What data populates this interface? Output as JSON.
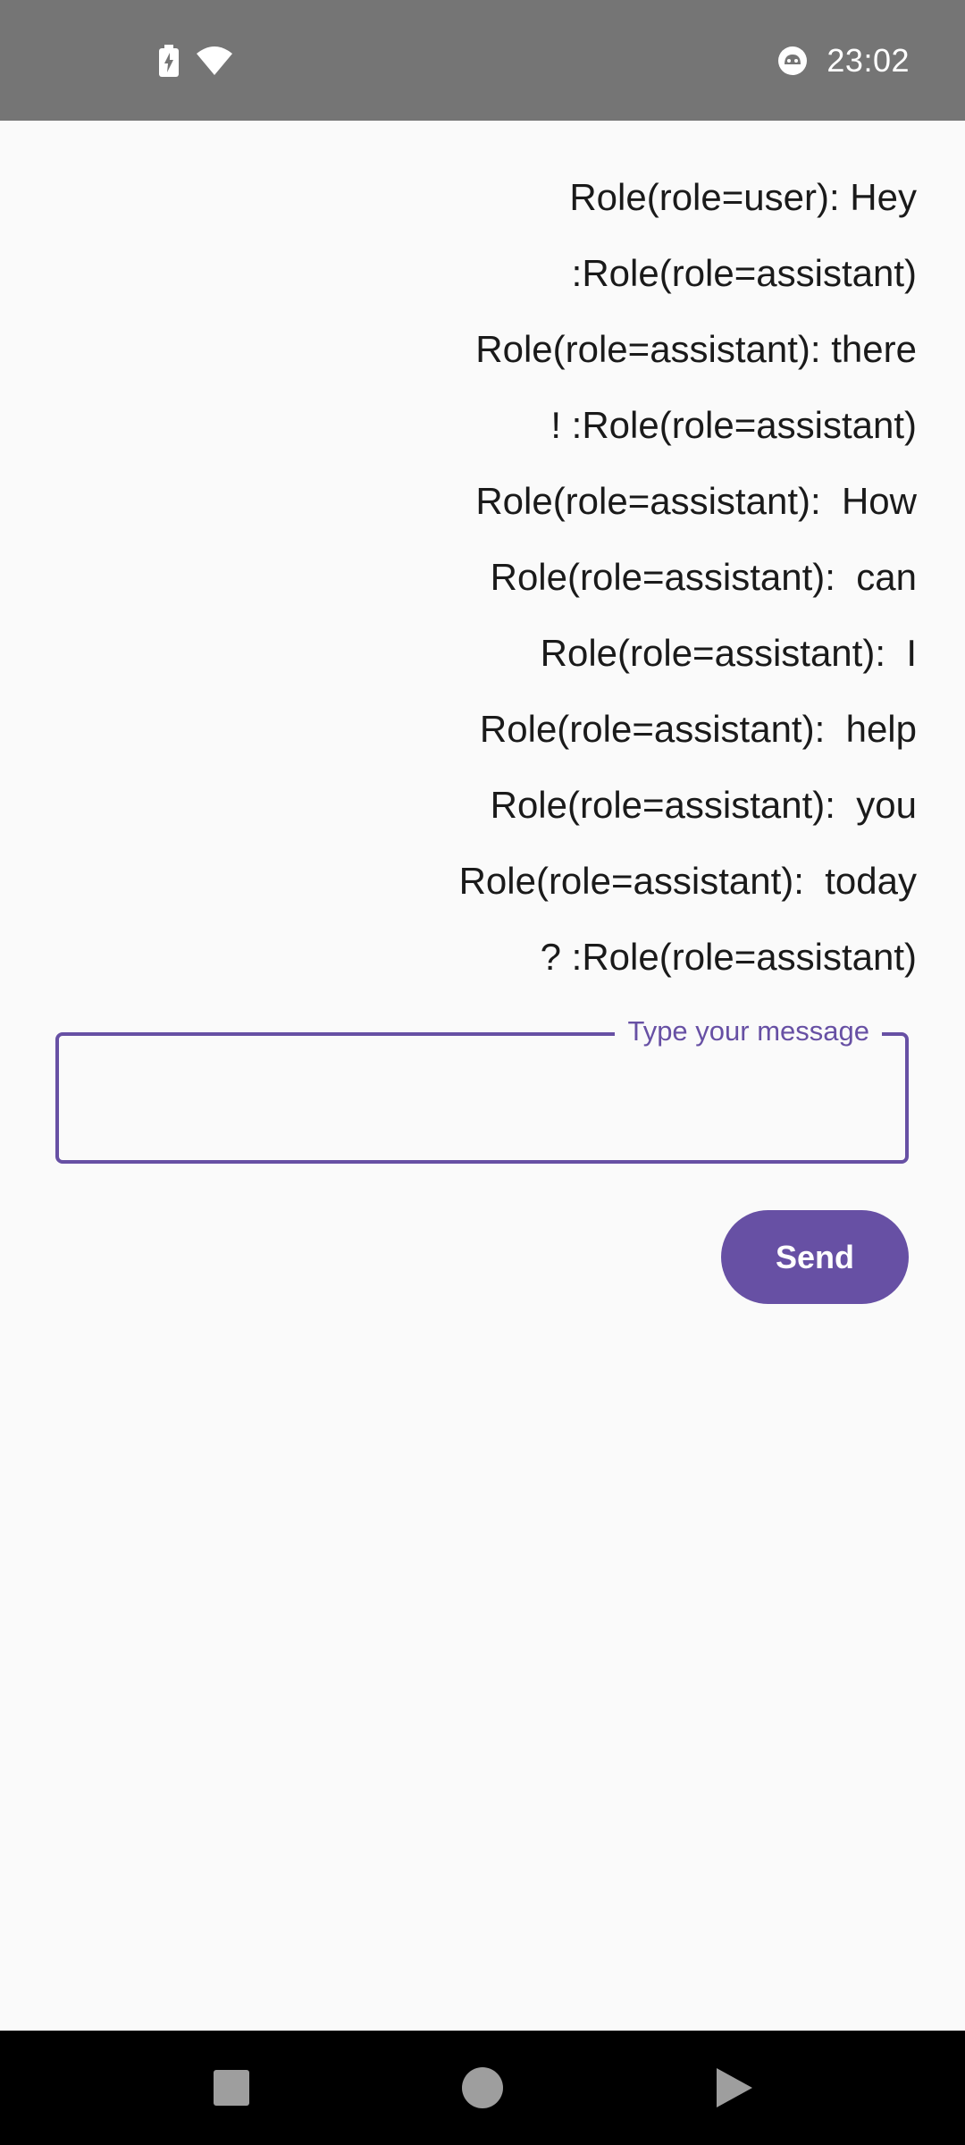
{
  "status_bar": {
    "time": "23:02",
    "icons": [
      "battery-charging-icon",
      "wifi-icon",
      "notification-face-icon"
    ]
  },
  "messages": [
    "Role(role=user): Hey",
    ":Role(role=assistant)",
    "Role(role=assistant): there",
    "! :Role(role=assistant)",
    "Role(role=assistant):  How",
    "Role(role=assistant):  can",
    "Role(role=assistant):  I",
    "Role(role=assistant):  help",
    "Role(role=assistant):  you",
    "Role(role=assistant):  today",
    "? :Role(role=assistant)"
  ],
  "input": {
    "label": "Type your message",
    "value": ""
  },
  "send_button": {
    "label": "Send"
  },
  "nav_bar": {
    "icons": [
      "recents-square-icon",
      "home-circle-icon",
      "back-triangle-icon"
    ]
  },
  "colors": {
    "accent": "#6750a4",
    "status_bar": "#757575",
    "background": "#fafafa",
    "nav_bar": "#000000"
  }
}
